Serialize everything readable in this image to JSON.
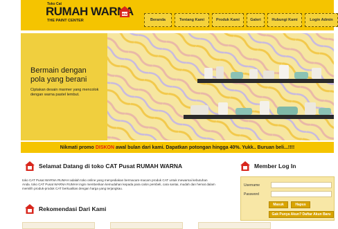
{
  "header": {
    "logo_small": "Toko Cat",
    "logo_main": "RUMAH WARNA",
    "logo_sub": "THE PAINT CENTER",
    "logo_badge": "RW"
  },
  "nav": [
    {
      "label": "Beranda"
    },
    {
      "label": "Tentang Kami"
    },
    {
      "label": "Produk Kami"
    },
    {
      "label": "Galeri"
    },
    {
      "label": "Hubungi Kami"
    },
    {
      "label": "Login Admin"
    }
  ],
  "hero": {
    "title_line1": "Bermain dengan",
    "title_line2": "pola yang berani",
    "desc_line1": "Ciptakan desain marmer yang mencolok",
    "desc_line2": "dengan warna pastel lembut."
  },
  "promo": {
    "before": "Nikmati promo",
    "highlight": "DISKON",
    "after": "awal bulan dari kami. Dapatkan potongan hingga 40%. Yukk.. Buruan beli...!!!!"
  },
  "welcome": {
    "title": "Selamat Datang di toko CAT Pusat RUMAH WARNA",
    "body": "toko CAT Pusat WARNA RUMAH adalah toko online yang menyediakan bermacam-macam produk CAT untuk mewarnai kebutuhan Anda. toko CAT Pusat WARNA RUMAH ingin memberikan kemudahan kepada para calon pembeli, cara santai, mudah dan hemat dalam memilih produk-produk CAT berkualitas dengan harga yang terjangkau."
  },
  "recommend": {
    "title": "Rekomendasi Dari Kami"
  },
  "login": {
    "title": "Member Log In",
    "username_label": "Username",
    "password_label": "Password",
    "login_btn": "Masuk",
    "reset_btn": "Hapus",
    "register_btn": "Gak Punya Akun? Daftar Akun Baru"
  },
  "colors": {
    "brand_yellow": "#f5c400",
    "promo_red": "#e02010",
    "button_gold": "#d9a400"
  }
}
